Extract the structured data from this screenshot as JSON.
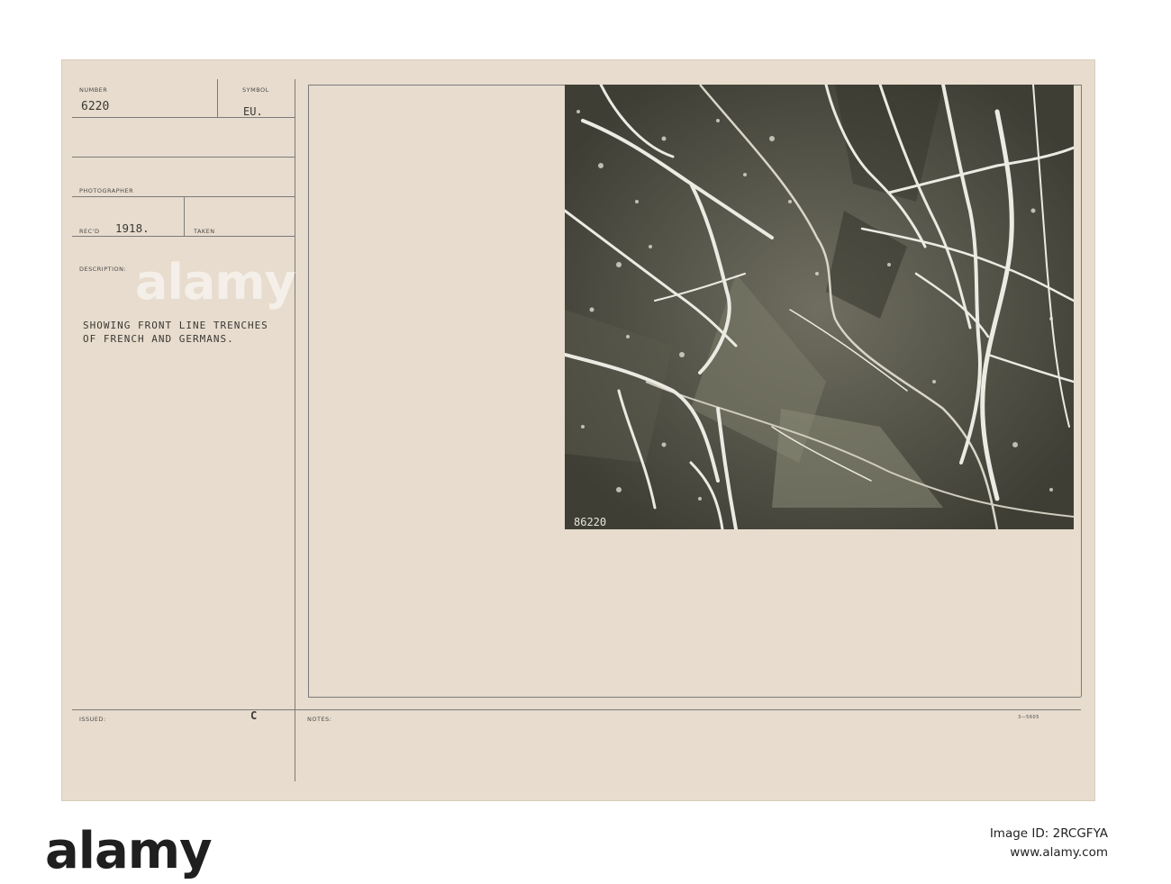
{
  "card": {
    "number_label": "NUMBER",
    "number_value": "6220",
    "symbol_label": "SYMBOL",
    "symbol_value": "EU.",
    "photographer_label": "PHOTOGRAPHER",
    "recd_label": "REC'D",
    "recd_value": "1918.",
    "taken_label": "TAKEN",
    "description_label": "DESCRIPTION:",
    "description_line1": "SHOWING FRONT LINE TRENCHES",
    "description_line2": "OF FRENCH AND GERMANS.",
    "issued_label": "ISSUED:",
    "issued_mark": "C",
    "notes_label": "NOTES:",
    "form_code": "3—5605"
  },
  "photo": {
    "negative_number": "86220"
  },
  "watermark": {
    "logo": "alamy",
    "image_id": "Image ID: 2RCGFYA",
    "site": "www.alamy.com"
  }
}
